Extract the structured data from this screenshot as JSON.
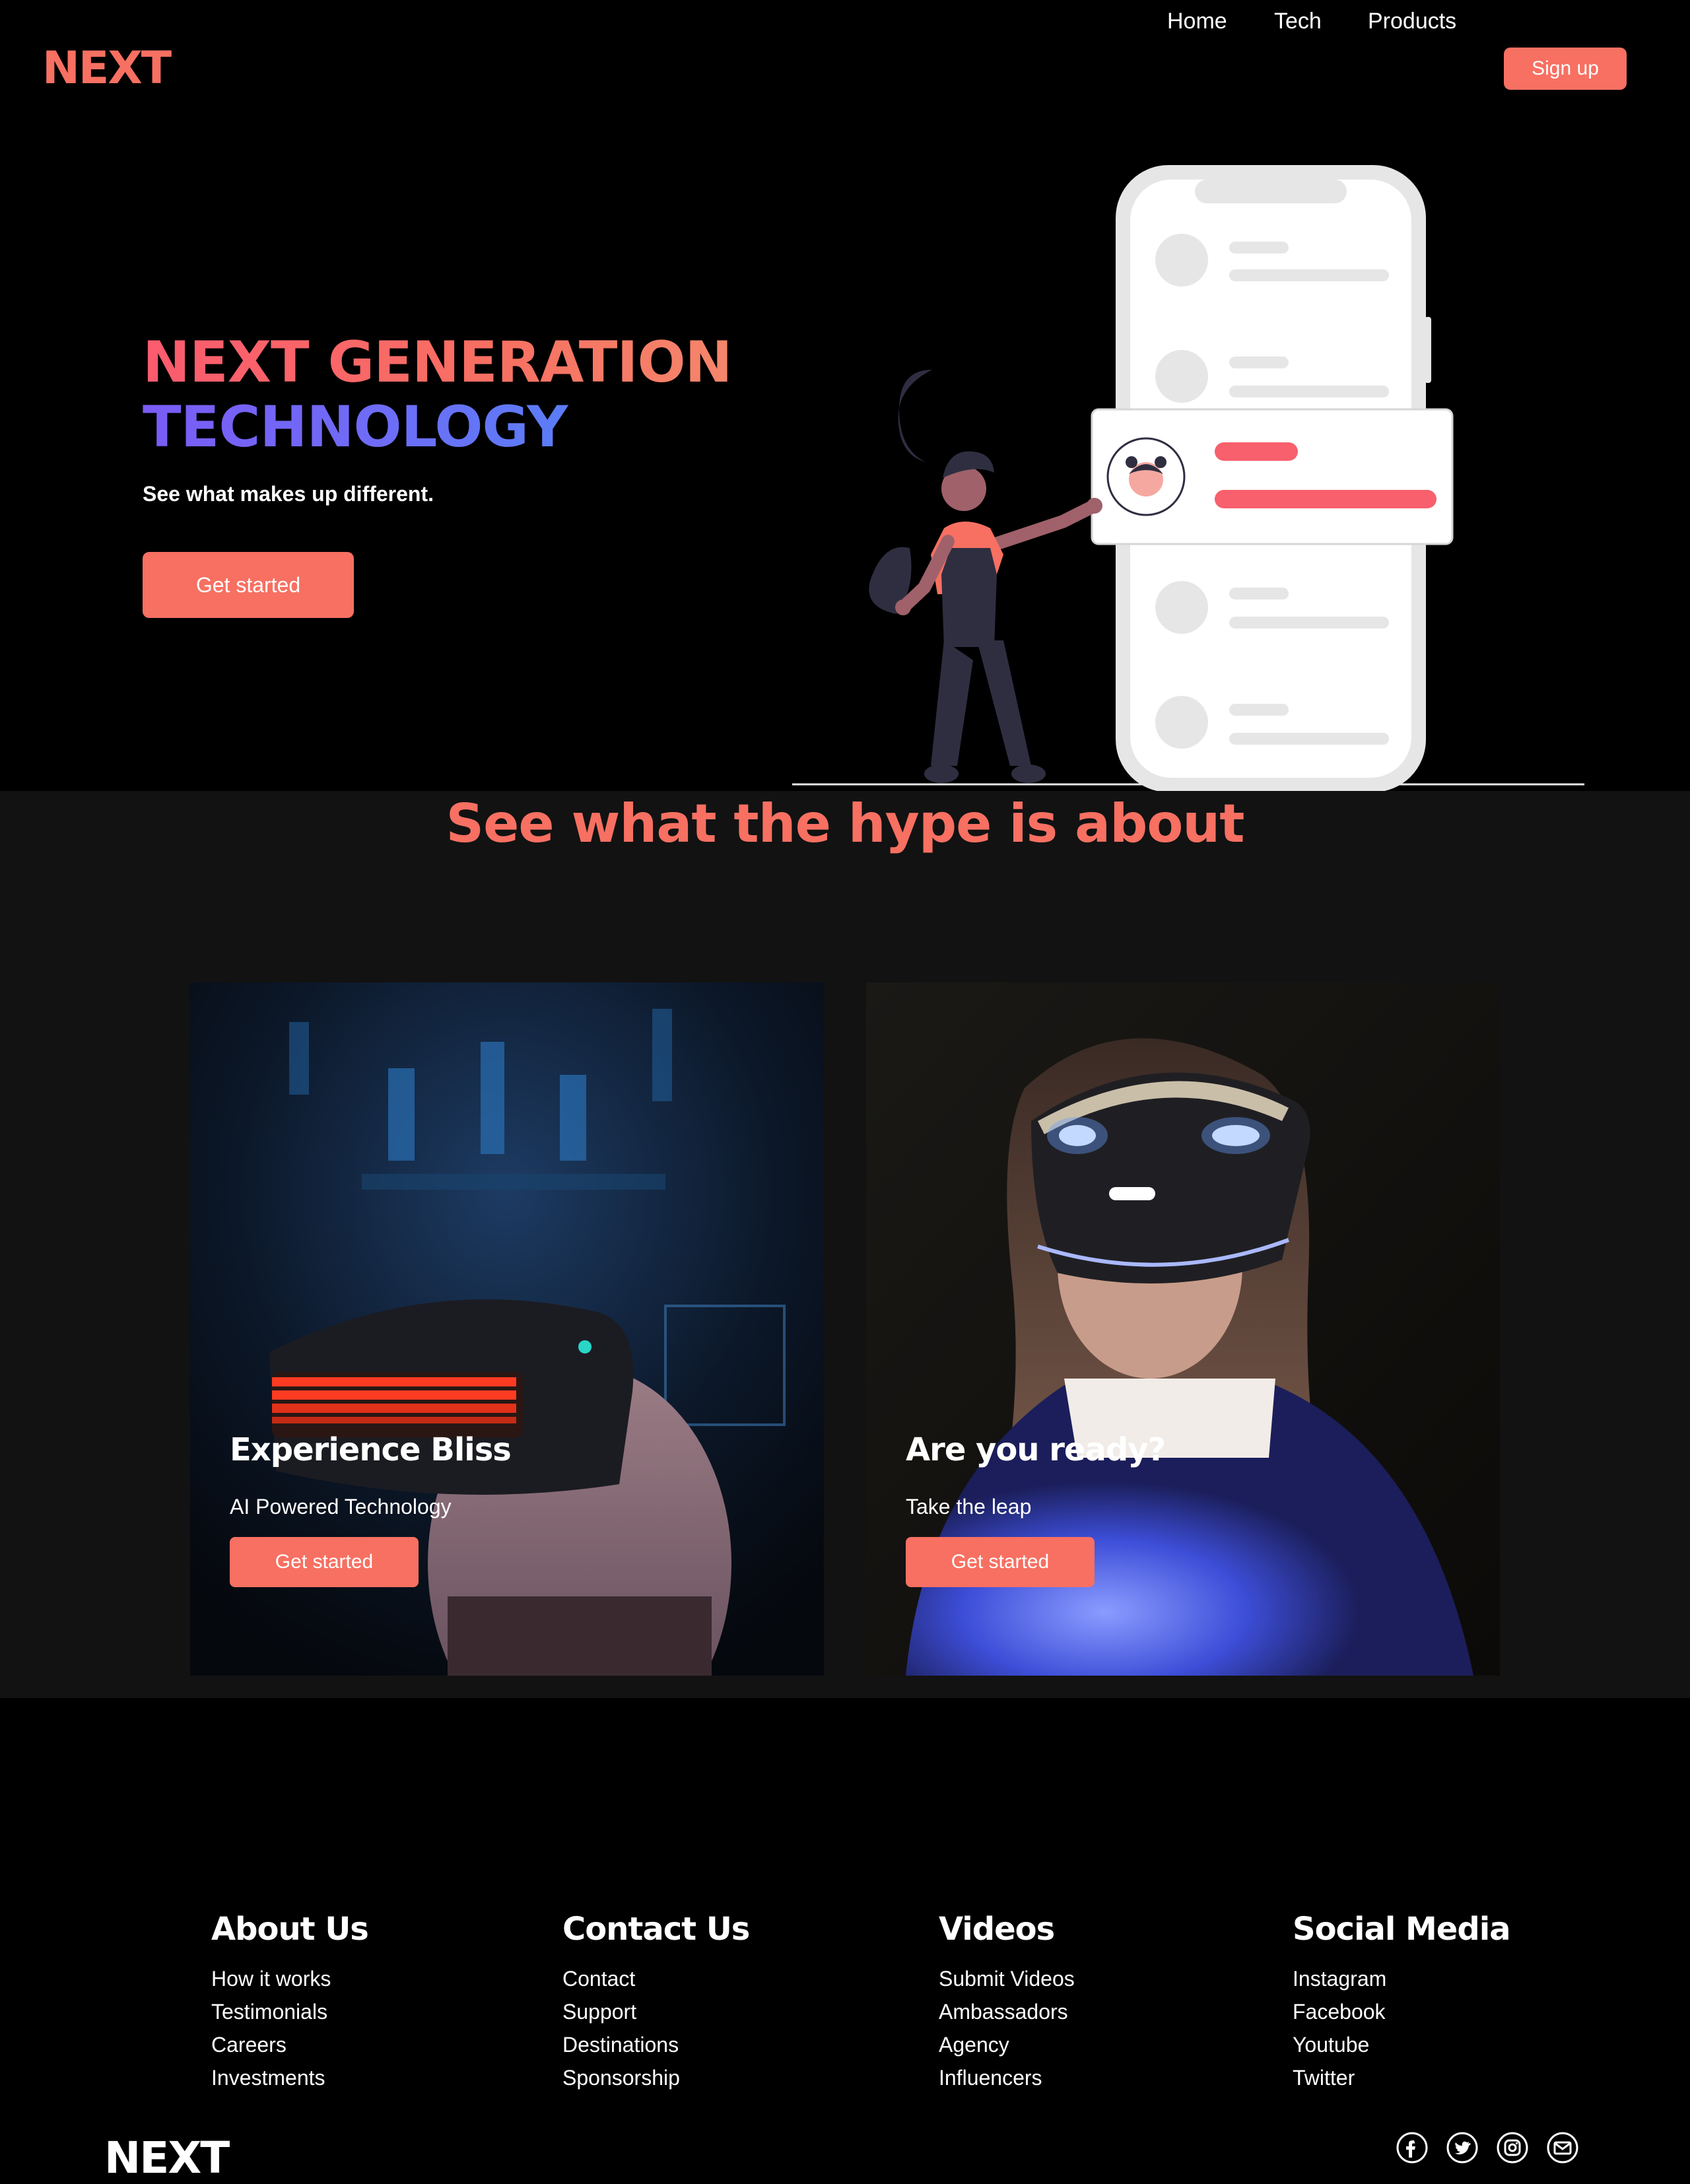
{
  "nav": {
    "logo": "NEXT",
    "links": [
      "Home",
      "Tech",
      "Products"
    ],
    "signup_label": "Sign up"
  },
  "hero": {
    "title_line1": "NEXT GENERATION",
    "title_line2": "TECHNOLOGY",
    "subtitle": "See what makes up different.",
    "cta_label": "Get started"
  },
  "hype": {
    "title": "See what the hype is about",
    "cards": [
      {
        "title": "Experience Bliss",
        "subtitle": "AI Powered Technology",
        "cta_label": "Get started"
      },
      {
        "title": "Are you ready?",
        "subtitle": "Take the leap",
        "cta_label": "Get started"
      }
    ]
  },
  "footer": {
    "columns": [
      {
        "heading": "About Us",
        "links": [
          "How it works",
          "Testimonials",
          "Careers",
          "Investments"
        ]
      },
      {
        "heading": "Contact Us",
        "links": [
          "Contact",
          "Support",
          "Destinations",
          "Sponsorship"
        ]
      },
      {
        "heading": "Videos",
        "links": [
          "Submit Videos",
          "Ambassadors",
          "Agency",
          "Influencers"
        ]
      },
      {
        "heading": "Social Media",
        "links": [
          "Instagram",
          "Facebook",
          "Youtube",
          "Twitter"
        ]
      }
    ],
    "logo": "NEXT",
    "social_icons": [
      "facebook-icon",
      "twitter-icon",
      "instagram-icon",
      "mail-icon"
    ]
  },
  "colors": {
    "accent": "#f77062",
    "background": "#000000",
    "section_bg": "#121212",
    "gradient_purple": "#6e6cf7"
  }
}
